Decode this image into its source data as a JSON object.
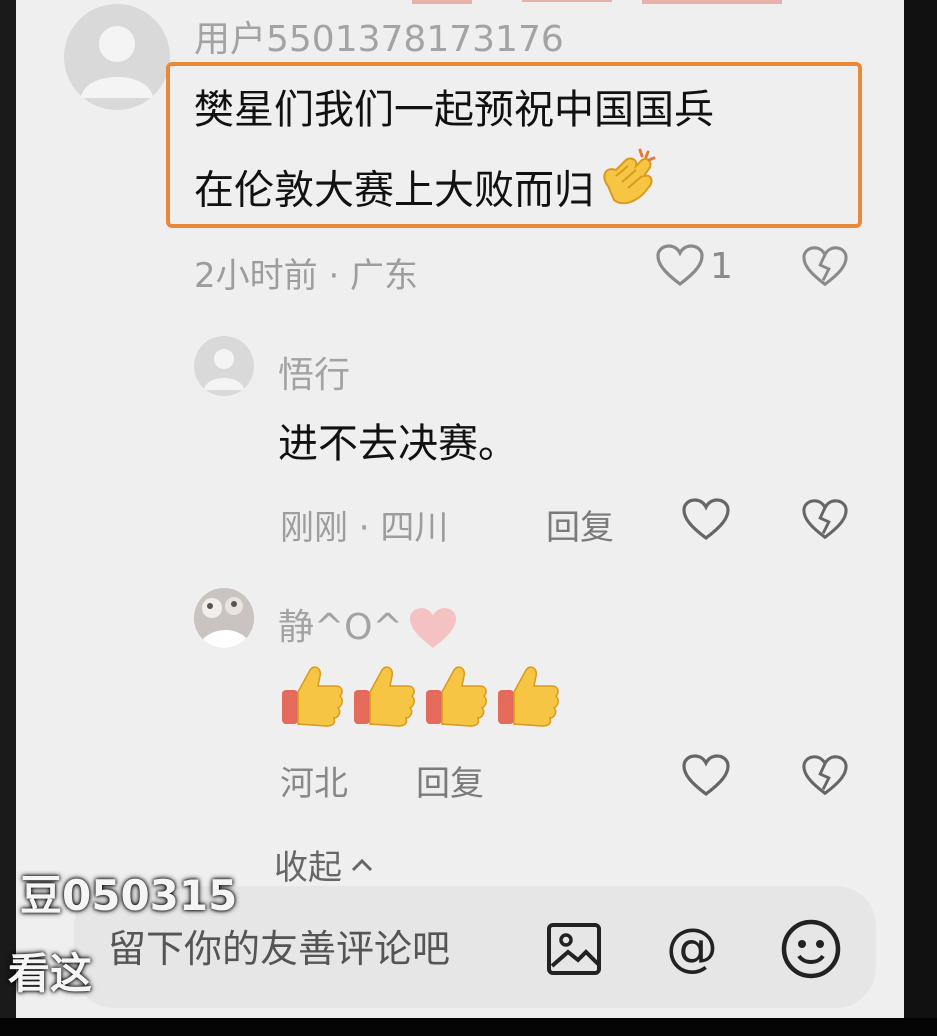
{
  "comment1": {
    "username": "用户5501378173176",
    "text_line1": "樊星们我们一起预祝中国国兵",
    "text_line2": "在伦敦大赛上大败而归",
    "time": "2小时前 · 广东",
    "like_count": "1"
  },
  "reply1": {
    "username": "悟行",
    "text": "进不去决赛。",
    "time": "刚刚 · 四川",
    "reply_label": "回复"
  },
  "reply2": {
    "username": "静^O^",
    "location": "河北",
    "reply_label": "回复",
    "thumbs_count": 4
  },
  "collapse_label": "收起",
  "composer": {
    "placeholder": "留下你的友善评论吧"
  },
  "overlay": {
    "line1": "豆050315",
    "line2": "看这"
  },
  "colors": {
    "highlight_border": "#e98937",
    "background": "#efefef"
  },
  "icons": [
    "heart-icon",
    "dislike-heart-icon",
    "image-icon",
    "at-icon",
    "emoji-icon",
    "clap-emoji",
    "thumbs-up-emoji",
    "pink-heart-emoji",
    "chevron-up-icon"
  ]
}
